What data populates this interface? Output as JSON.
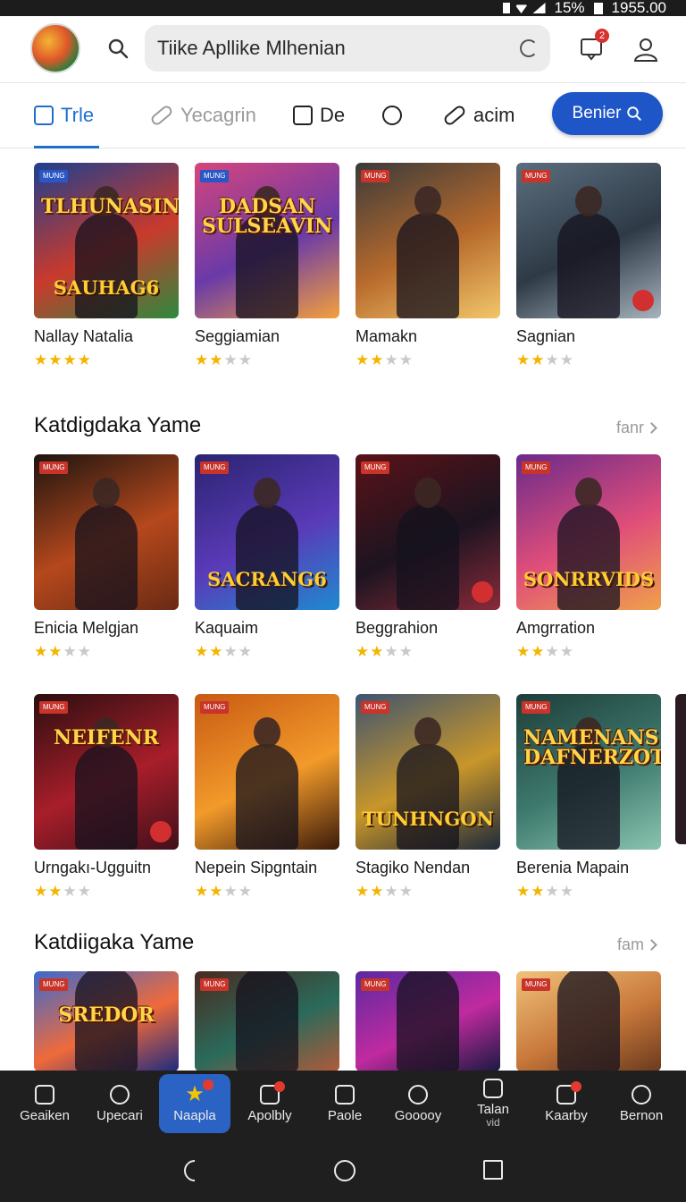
{
  "status": {
    "battery": "15%",
    "time": "1955.00"
  },
  "header": {
    "search_value": "Tiike Apllike Mlhenian",
    "notification_count": "2"
  },
  "tabs": [
    {
      "label": "Trle",
      "active": true
    },
    {
      "label": "Yecagrin",
      "muted": true
    },
    {
      "label": "De"
    },
    {
      "label": ""
    },
    {
      "label": "acim"
    }
  ],
  "tab_cta": {
    "label": "Benier"
  },
  "sections": [
    {
      "title": "",
      "see_all": "",
      "cards": [
        {
          "tag": "MUNG",
          "art_title": "TLHUNASIN",
          "art_sub": "SAUHAG6",
          "name": "Nallay Natalia",
          "rating": 4
        },
        {
          "tag": "MUNG",
          "art_title": "DADSAN SULSEAVIN",
          "art_sub": "",
          "name": "Seggiamian",
          "rating": 2
        },
        {
          "tag": "MUNG",
          "art_title": "",
          "art_sub": "",
          "name": "Mamakn",
          "rating": 2
        },
        {
          "tag": "MUNG",
          "art_title": "",
          "art_sub": "",
          "name": "Sagnian",
          "rating": 2
        }
      ]
    },
    {
      "title": "Katdigdaka Yame",
      "see_all": "fanr",
      "cards": [
        {
          "tag": "MUNG",
          "art_title": "",
          "art_sub": "",
          "name": "Enicia Melgjan",
          "rating": 2
        },
        {
          "tag": "MUNG",
          "art_title": "",
          "art_sub": "SACRANG6",
          "name": "Kaquaim",
          "rating": 2
        },
        {
          "tag": "MUNG",
          "art_title": "",
          "art_sub": "",
          "name": "Beggrahion",
          "rating": 2
        },
        {
          "tag": "MUNG",
          "art_title": "",
          "art_sub": "SONRRVIDS",
          "name": "Amgrration",
          "rating": 2
        }
      ]
    },
    {
      "title": "",
      "see_all": "",
      "cards": [
        {
          "tag": "MUNG",
          "art_title": "NEIFENR",
          "art_sub": "",
          "name": "Urngakı-Ugguitn",
          "rating": 2
        },
        {
          "tag": "MUNG",
          "art_title": "",
          "art_sub": "",
          "name": "Nepein Sipgntain",
          "rating": 2
        },
        {
          "tag": "MUNG",
          "art_title": "",
          "art_sub": "TUNHNGON",
          "name": "Stagiko Nendan",
          "rating": 2
        },
        {
          "tag": "MUNG",
          "art_title": "NAMENANS DAFNERZOTA",
          "art_sub": "",
          "name": "Berenia Mapain",
          "rating": 2
        }
      ]
    },
    {
      "title": "Katdiigaka Yame",
      "see_all": "fam",
      "cards": [
        {
          "tag": "MUNG",
          "art_title": "SREDOR",
          "art_sub": "",
          "name": "",
          "rating": 0
        },
        {
          "tag": "MUNG",
          "art_title": "",
          "art_sub": "",
          "name": "",
          "rating": 0
        },
        {
          "tag": "MUNG",
          "art_title": "",
          "art_sub": "",
          "name": "",
          "rating": 0
        },
        {
          "tag": "MUNG",
          "art_title": "",
          "art_sub": "",
          "name": "",
          "rating": 0
        }
      ]
    }
  ],
  "bottom_nav": [
    {
      "label": "Geaiken",
      "icon": "home-icon"
    },
    {
      "label": "Upecari",
      "icon": "chat-icon"
    },
    {
      "label": "Naapla",
      "icon": "star-icon",
      "active": true
    },
    {
      "label": "Apolbly",
      "icon": "bag-icon",
      "badge": true
    },
    {
      "label": "Paole",
      "icon": "camera-icon"
    },
    {
      "label": "Gooooy",
      "icon": "clock-icon"
    },
    {
      "label": "Talan",
      "sub": "vid",
      "icon": "window-icon"
    },
    {
      "label": "Kaarby",
      "icon": "bag-icon",
      "badge": true
    },
    {
      "label": "Bernon",
      "icon": "search-icon"
    }
  ],
  "colors": {
    "accent": "#1e56c8",
    "tab_active": "#1e6fcf",
    "star": "#f2b500",
    "nav_bg": "#1f1f1f",
    "badge": "#d9322e"
  }
}
